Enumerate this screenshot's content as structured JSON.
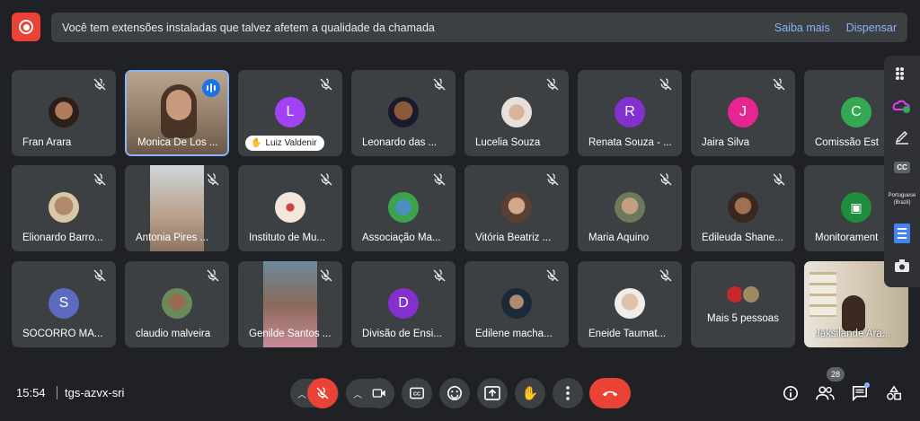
{
  "banner": {
    "message": "Você tem extensões instaladas que talvez afetem a qualidade da chamada",
    "learn_more": "Saiba mais",
    "dismiss": "Dispensar"
  },
  "tiles": [
    {
      "name": "Fran Arara",
      "avatar_letter": "",
      "avatar_color": ""
    },
    {
      "name": "Monica De Los ..."
    },
    {
      "name": "Luiz Valdenir"
    },
    {
      "name": "Leonardo das ..."
    },
    {
      "name": "Lucelia Souza"
    },
    {
      "name": "Renata Souza - ...",
      "avatar_letter": "R",
      "avatar_color": "#8430ce"
    },
    {
      "name": "Jaira Silva",
      "avatar_letter": "J",
      "avatar_color": "#e52592"
    },
    {
      "name": "Comissão Esta",
      "avatar_letter": "C",
      "avatar_color": "#34a853"
    },
    {
      "name": "Elionardo Barro..."
    },
    {
      "name": "Antonia Pires ..."
    },
    {
      "name": "Instituto de Mu..."
    },
    {
      "name": "Associação Ma..."
    },
    {
      "name": "Vitória Beatriz ..."
    },
    {
      "name": "Maria Aquino"
    },
    {
      "name": "Edileuda Shane..."
    },
    {
      "name": "Monitorament"
    },
    {
      "name": "SOCORRO MA...",
      "avatar_letter": "S",
      "avatar_color": "#5c6bc0"
    },
    {
      "name": "claudio malveira"
    },
    {
      "name": "Genilde Santos ..."
    },
    {
      "name": "Divisão de Ensi...",
      "avatar_letter": "D",
      "avatar_color": "#8430ce"
    },
    {
      "name": "Edilene macha..."
    },
    {
      "name": "Eneide Taumat..."
    },
    {
      "name": "Mais 5 pessoas"
    },
    {
      "name": "Jaksilande Ara..."
    }
  ],
  "luiz_letter": "L",
  "side_panel": {
    "language": "Portuguese (Brazil)",
    "cc": "CC"
  },
  "bottom_bar": {
    "time": "15:54",
    "meeting_code": "tgs-azvx-sri",
    "participants_count": "28"
  }
}
